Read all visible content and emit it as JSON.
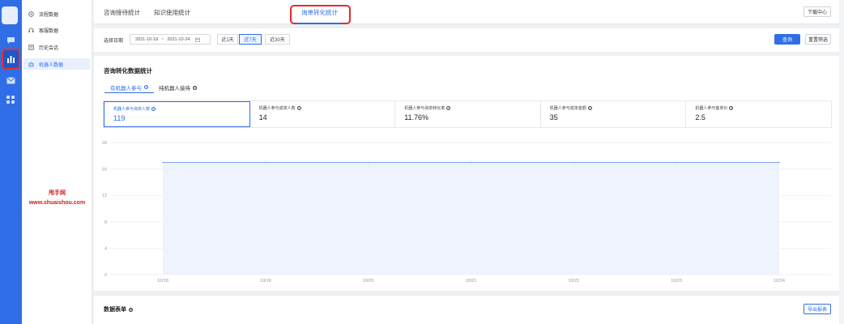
{
  "rail": {
    "icons": [
      "chat-bubble-icon",
      "bar-chart-icon",
      "mail-icon",
      "apps-grid-icon"
    ],
    "active_color": "#e83030",
    "bg_color": "#2f6ee6"
  },
  "menu": {
    "items": [
      {
        "label": "流程数据",
        "icon": "flow-icon"
      },
      {
        "label": "客服数据",
        "icon": "headset-icon"
      },
      {
        "label": "历史会话",
        "icon": "history-icon"
      },
      {
        "label": "机器人数据",
        "icon": "robot-icon",
        "active": true
      }
    ]
  },
  "watermark": {
    "line1": "甩手网",
    "line2": "www.shuaishou.com"
  },
  "tabs": [
    {
      "label": "咨询接待统计"
    },
    {
      "label": "知识使用统计"
    },
    {
      "label": "询单转化统计",
      "active": true
    }
  ],
  "download_center": "下载中心",
  "filter": {
    "label": "选择日期",
    "start": "2021-10-18",
    "separator": "~",
    "end": "2021-10-24",
    "quick_ranges": [
      "近1天",
      "近7天",
      "近30天"
    ],
    "active_range": "近7天",
    "query": "查询",
    "reset": "重置筛选"
  },
  "panel": {
    "title": "咨询转化数据统计",
    "segments": [
      "有机器人参与",
      "纯机器人接待"
    ],
    "cards": [
      {
        "label": "机器人参与询单人数",
        "value": "119"
      },
      {
        "label": "机器人参与成单人数",
        "value": "14"
      },
      {
        "label": "机器人参与询单转化率",
        "value": "11.76%"
      },
      {
        "label": "机器人参与成单金额",
        "value": "35"
      },
      {
        "label": "机器人参与客单价",
        "value": "2.5"
      }
    ]
  },
  "chart_data": {
    "type": "area",
    "x": [
      "10/18",
      "10/19",
      "10/20",
      "10/21",
      "10/22",
      "10/23",
      "10/24"
    ],
    "series": [
      {
        "values": [
          17,
          17,
          17,
          17,
          17,
          17,
          17
        ]
      }
    ],
    "yticks": [
      "0",
      "4",
      "8",
      "12",
      "16",
      "20"
    ],
    "ylim": [
      0,
      20
    ],
    "grid": true,
    "line_color": "#7aa7f0",
    "fill_color": "#eef3fd"
  },
  "table_section": {
    "title": "数据表单",
    "export": "导出报表"
  }
}
